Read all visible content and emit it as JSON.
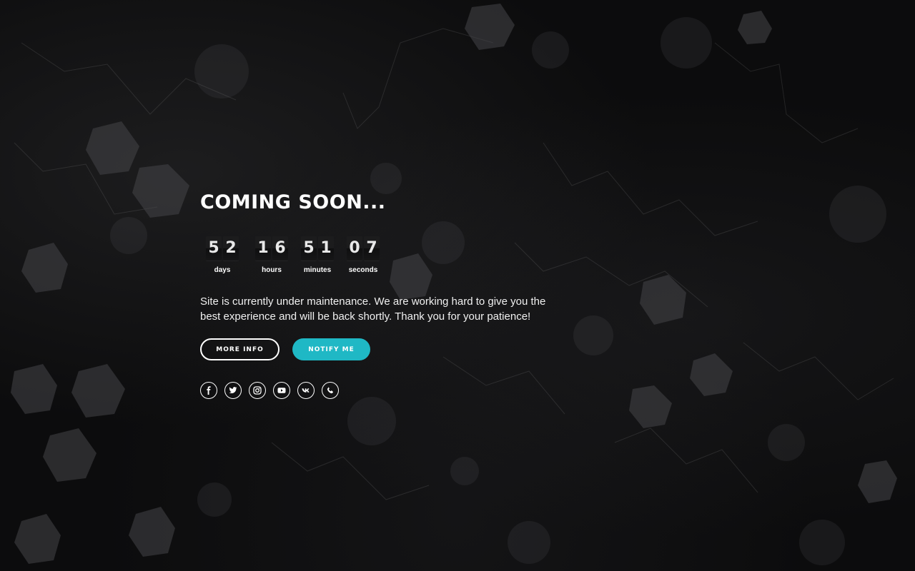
{
  "page": {
    "title": "COMING SOON...",
    "message": "Site is currently under maintenance. We are working hard to give you the best experience and will be back shortly. Thank you for your patience!"
  },
  "countdown": [
    {
      "digits": [
        "5",
        "2"
      ],
      "label": "days"
    },
    {
      "digits": [
        "1",
        "6"
      ],
      "label": "hours"
    },
    {
      "digits": [
        "5",
        "1"
      ],
      "label": "minutes"
    },
    {
      "digits": [
        "0",
        "7"
      ],
      "label": "seconds"
    }
  ],
  "buttons": {
    "more_info": "MORE INFO",
    "notify_me": "NOTIFY ME"
  },
  "social_icons": [
    "facebook-icon",
    "twitter-icon",
    "instagram-icon",
    "youtube-icon",
    "vk-icon",
    "phone-icon"
  ],
  "colors": {
    "background": "#0c0c0d",
    "accent": "#1fb8c5",
    "text": "#ffffff"
  }
}
